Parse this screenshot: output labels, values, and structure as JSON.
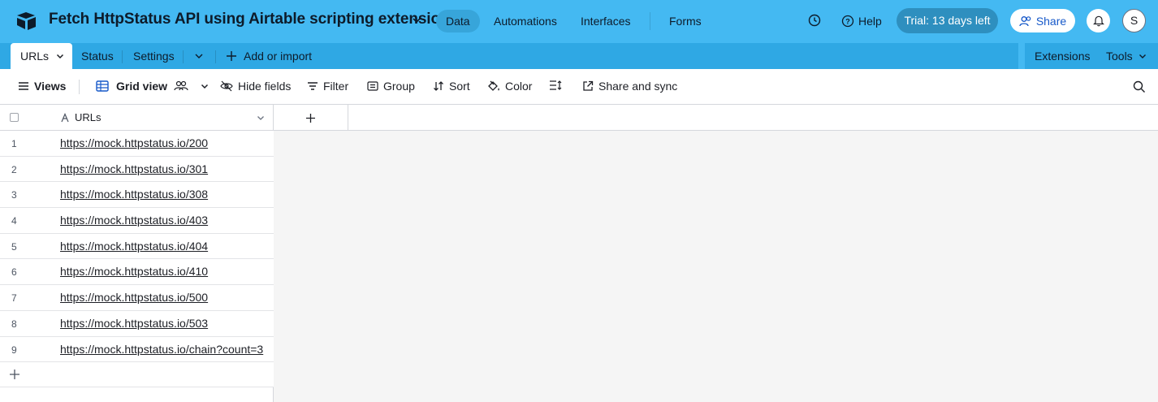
{
  "header": {
    "base_title": "Fetch HttpStatus API using Airtable scripting extension",
    "nav": [
      "Data",
      "Automations",
      "Interfaces",
      "Forms"
    ],
    "active_nav": "Data",
    "help_label": "Help",
    "trial_label": "Trial: 13 days left",
    "share_label": "Share",
    "avatar_initial": "S"
  },
  "tables": {
    "active_tab": "URLs",
    "tabs": [
      "Status",
      "Settings"
    ],
    "add_import_label": "Add or import",
    "extensions_label": "Extensions",
    "tools_label": "Tools"
  },
  "toolbar": {
    "views_label": "Views",
    "grid_view_label": "Grid view",
    "hide_fields_label": "Hide fields",
    "filter_label": "Filter",
    "group_label": "Group",
    "sort_label": "Sort",
    "color_label": "Color",
    "share_sync_label": "Share and sync"
  },
  "grid": {
    "field_name": "URLs",
    "rows": [
      {
        "num": "1",
        "url": "https://mock.httpstatus.io/200"
      },
      {
        "num": "2",
        "url": "https://mock.httpstatus.io/301"
      },
      {
        "num": "3",
        "url": "https://mock.httpstatus.io/308"
      },
      {
        "num": "4",
        "url": "https://mock.httpstatus.io/403"
      },
      {
        "num": "5",
        "url": "https://mock.httpstatus.io/404"
      },
      {
        "num": "6",
        "url": "https://mock.httpstatus.io/410"
      },
      {
        "num": "7",
        "url": "https://mock.httpstatus.io/500"
      },
      {
        "num": "8",
        "url": "https://mock.httpstatus.io/503"
      },
      {
        "num": "9",
        "url": "https://mock.httpstatus.io/chain?count=3"
      }
    ]
  },
  "colors": {
    "header_bg": "#44b9f2",
    "trial_bg": "#2e8fbf",
    "share_text": "#1759c9"
  },
  "icons": [
    "airtable-logo-icon",
    "chevron-down-icon",
    "history-icon",
    "help-icon",
    "share-people-icon",
    "bell-icon",
    "plus-icon",
    "menu-icon",
    "grid-icon",
    "collaborators-icon",
    "eye-off-icon",
    "filter-icon",
    "group-icon",
    "sort-icon",
    "paint-bucket-icon",
    "row-height-icon",
    "external-share-icon",
    "search-icon",
    "text-field-icon"
  ]
}
